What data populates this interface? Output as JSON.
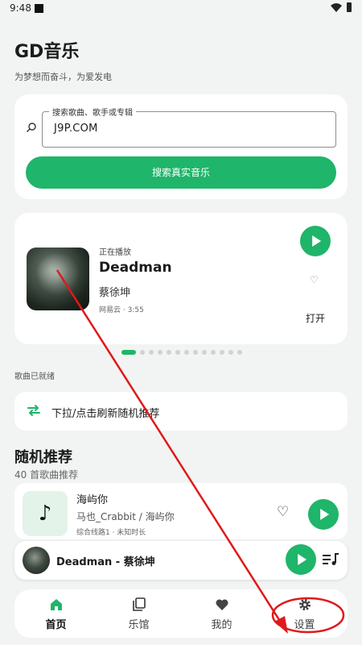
{
  "status": {
    "time": "9:48"
  },
  "header": {
    "title": "GD音乐",
    "subtitle": "为梦想而奋斗，为爱发电"
  },
  "search": {
    "label": "搜索歌曲、歌手或专辑",
    "value": "J9P.COM",
    "button_label": "搜索真实音乐"
  },
  "now_playing": {
    "status_label": "正在播放",
    "title": "Deadman",
    "artist": "蔡徐坤",
    "meta": "网易云 · 3:55",
    "open_label": "打开"
  },
  "carousel": {
    "page_count": 13,
    "active_index": 0
  },
  "ready_text": "歌曲已就绪",
  "refresh": {
    "label": "下拉/点击刷新随机推荐"
  },
  "recommend": {
    "title": "随机推荐",
    "count_text": "40 首歌曲推荐"
  },
  "song": {
    "title": "海屿你",
    "artist": "马也_Crabbit / 海屿你",
    "meta": "综合线路1 · 未知时长"
  },
  "mini_player": {
    "title": "Deadman - 蔡徐坤"
  },
  "nav": [
    {
      "label": "首页",
      "icon": "home-icon",
      "active": true
    },
    {
      "label": "乐馆",
      "icon": "library-icon",
      "active": false
    },
    {
      "label": "我的",
      "icon": "heart-icon",
      "active": false
    },
    {
      "label": "设置",
      "icon": "gear-icon",
      "active": false
    }
  ],
  "colors": {
    "accent": "#1fb56a",
    "annotation": "#e0191b"
  }
}
